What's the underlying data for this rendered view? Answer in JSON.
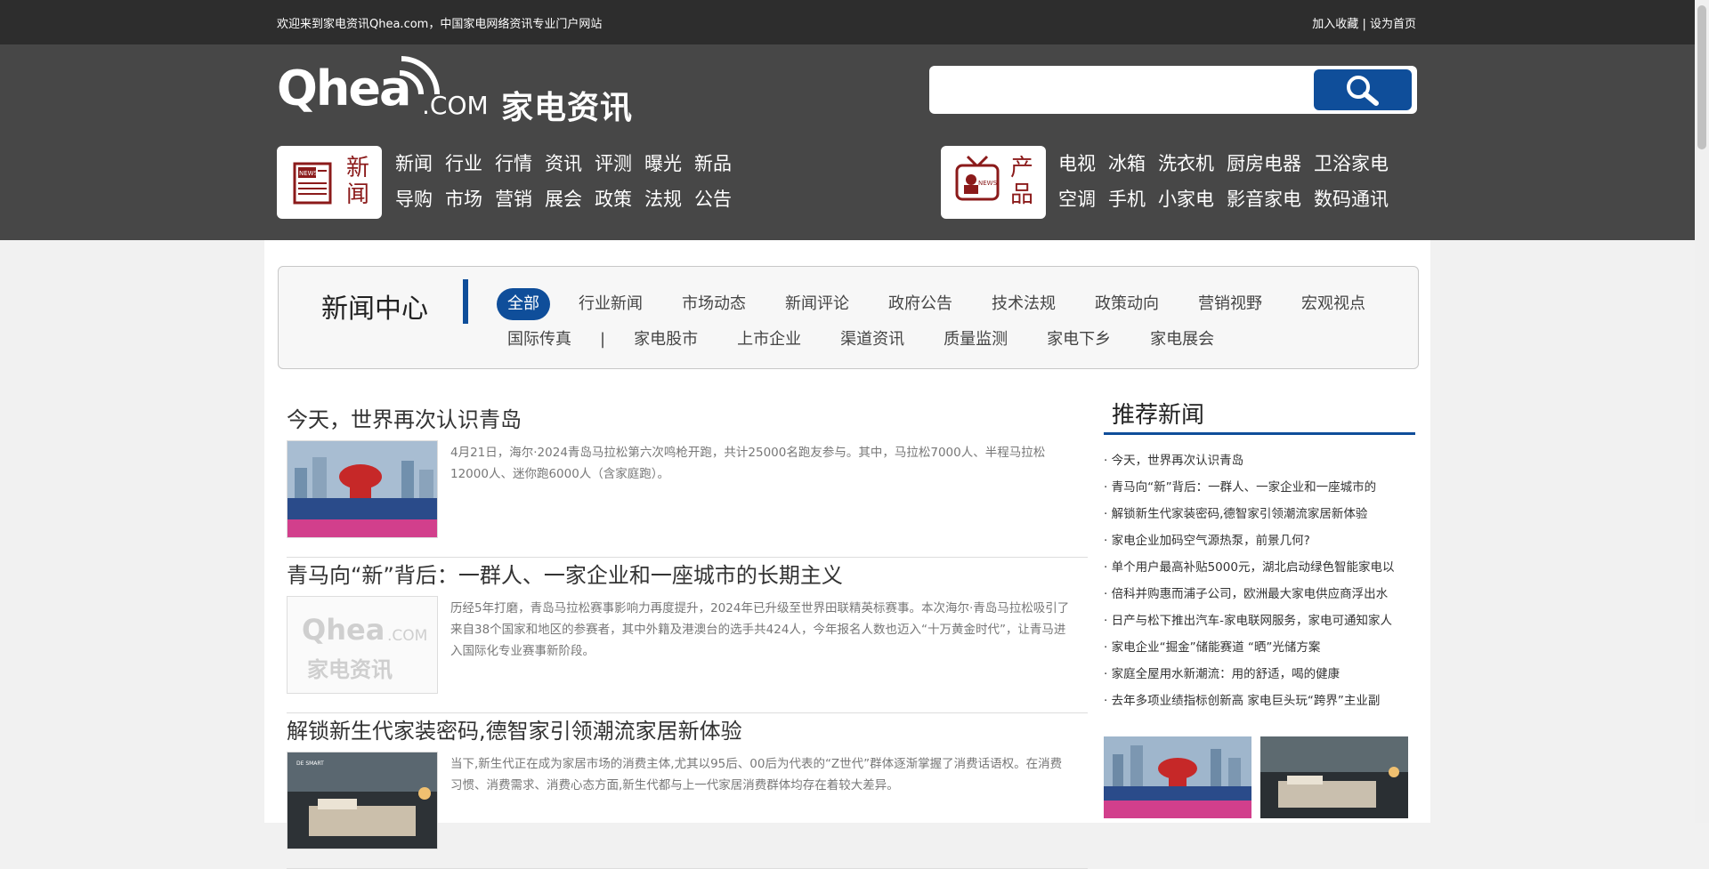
{
  "topbar": {
    "welcome": "欢迎来到家电资讯Qhea.com，中国家电网络资讯专业门户网站",
    "bookmark": "加入收藏",
    "separator": "|",
    "homepage": "设为首页"
  },
  "logo": {
    "mark": "Qhea",
    "com": ".COM",
    "cn": "家电资讯"
  },
  "search": {
    "placeholder": ""
  },
  "nav_news": {
    "label": "新闻",
    "badge": "NEWS",
    "row1": [
      "新闻",
      "行业",
      "行情",
      "资讯",
      "评测",
      "曝光",
      "新品"
    ],
    "row2": [
      "导购",
      "市场",
      "营销",
      "展会",
      "政策",
      "法规",
      "公告"
    ]
  },
  "nav_products": {
    "label": "产品",
    "badge": "NEWS",
    "row1": [
      "电视",
      "冰箱",
      "洗衣机",
      "厨房电器",
      "卫浴家电"
    ],
    "row2": [
      "空调",
      "手机",
      "小家电",
      "影音家电",
      "数码通讯"
    ]
  },
  "category": {
    "title": "新闻中心",
    "tabs": [
      "全部",
      "行业新闻",
      "市场动态",
      "新闻评论",
      "政府公告",
      "技术法规",
      "政策动向",
      "营销视野",
      "宏观视点",
      "国际传真",
      "|",
      "家电股市",
      "上市企业",
      "渠道资讯",
      "质量监测",
      "家电下乡",
      "家电展会"
    ],
    "active": "全部"
  },
  "articles": [
    {
      "title": "今天，世界再次认识青岛",
      "summary": "4月21日，海尔·2024青岛马拉松第六次鸣枪开跑，共计25000名跑友参与。其中，马拉松7000人、半程马拉松12000人、迷你跑6000人（含家庭跑）。",
      "thumb": "marathon"
    },
    {
      "title": "青马向“新”背后：一群人、一家企业和一座城市的长期主义",
      "summary": "历经5年打磨，青岛马拉松赛事影响力再度提升，2024年已升级至世界田联精英标赛事。本次海尔·青岛马拉松吸引了来自38个国家和地区的参赛者，其中外籍及港澳台的选手共424人，今年报名人数也迈入“十万黄金时代”，让青马进入国际化专业赛事新阶段。",
      "thumb": "logo"
    },
    {
      "title": "解锁新生代家装密码,德智家引领潮流家居新体验",
      "summary": "当下,新生代正在成为家居市场的消费主体,尤其以95后、00后为代表的“Z世代”群体逐渐掌握了消费话语权。在消费习惯、消费需求、消费心态方面,新生代都与上一代家居消费群体均存在着较大差异。",
      "thumb": "bedroom"
    }
  ],
  "thumb_logo": {
    "mark": "Qhea",
    "com": ".COM",
    "cn": "家电资讯"
  },
  "thumb_bedroom_text": "DE SMART",
  "sidebar": {
    "title": "推荐新闻",
    "items": [
      "· 今天，世界再次认识青岛",
      "· 青马向“新”背后：一群人、一家企业和一座城市的",
      "· 解锁新生代家装密码,德智家引领潮流家居新体验",
      "· 家电企业加码空气源热泵，前景几何?",
      "· 单个用户最高补贴5000元，湖北启动绿色智能家电以",
      "· 倍科并购惠而浦子公司，欧洲最大家电供应商浮出水",
      "· 日产与松下推出汽车-家电联网服务，家电可通知家人",
      "· 家电企业“掘金”储能赛道 “晒”光储方案",
      "· 家庭全屋用水新潮流：用的舒适，喝的健康",
      "· 去年多项业绩指标创新高 家电巨头玩“跨界”主业副"
    ]
  },
  "colors": {
    "brand_blue": "#0f4e9a",
    "header_dark": "#474747",
    "topbar": "#2d2d2d",
    "news_red": "#8b1a1a"
  },
  "icons": {
    "search": "magnifier-icon",
    "news": "newspaper-icon",
    "products": "tv-icon"
  }
}
